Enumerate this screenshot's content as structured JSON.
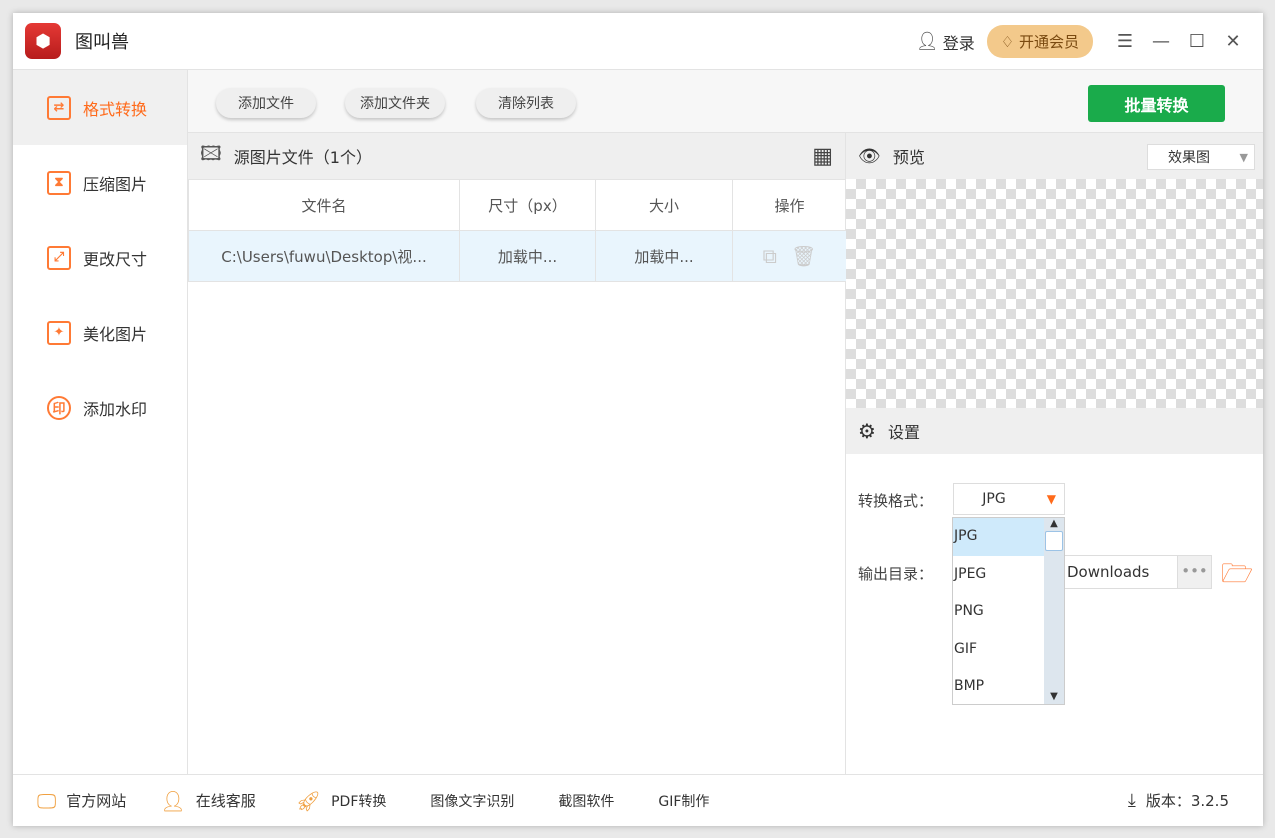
{
  "app": {
    "title": "图叫兽",
    "logo": "图"
  },
  "titlebar": {
    "login": "登录",
    "vip": "开通会员",
    "menu_icon": "☰",
    "minimize": "—",
    "maximize": "☐",
    "close": "✕"
  },
  "sidebar": {
    "items": [
      {
        "label": "格式转换",
        "icon": "⇄",
        "active": true
      },
      {
        "label": "压缩图片",
        "icon": "⧗"
      },
      {
        "label": "更改尺寸",
        "icon": "⤢"
      },
      {
        "label": "美化图片",
        "icon": "✦"
      },
      {
        "label": "添加水印",
        "icon": "印"
      }
    ]
  },
  "toolbar": {
    "add_file": "添加文件",
    "add_folder": "添加文件夹",
    "clear_list": "清除列表",
    "batch_convert": "批量转换"
  },
  "filelist": {
    "title": "源图片文件（1个）",
    "columns": [
      "文件名",
      "尺寸（px）",
      "大小",
      "操作"
    ],
    "rows": [
      {
        "name": "C:\\Users\\fuwu\\Desktop\\视...",
        "size_px": "加载中...",
        "size": "加载中..."
      }
    ]
  },
  "preview": {
    "title": "预览",
    "mode": "效果图"
  },
  "settings": {
    "title": "设置",
    "format_label": "转换格式：",
    "format_value": "JPG",
    "format_options": [
      "JPG",
      "JPEG",
      "PNG",
      "GIF",
      "BMP"
    ],
    "output_label": "输出目录：",
    "output_value": "Downloads",
    "browse": "•••"
  },
  "footer": {
    "items": [
      "官方网站",
      "在线客服",
      "PDF转换",
      "图像文字识别",
      "截图软件",
      "GIF制作"
    ],
    "version": "版本：3.2.5"
  },
  "colors": {
    "accent": "#ff6a1a",
    "batch": "#1aab4b",
    "vip": "#f3c98b"
  }
}
